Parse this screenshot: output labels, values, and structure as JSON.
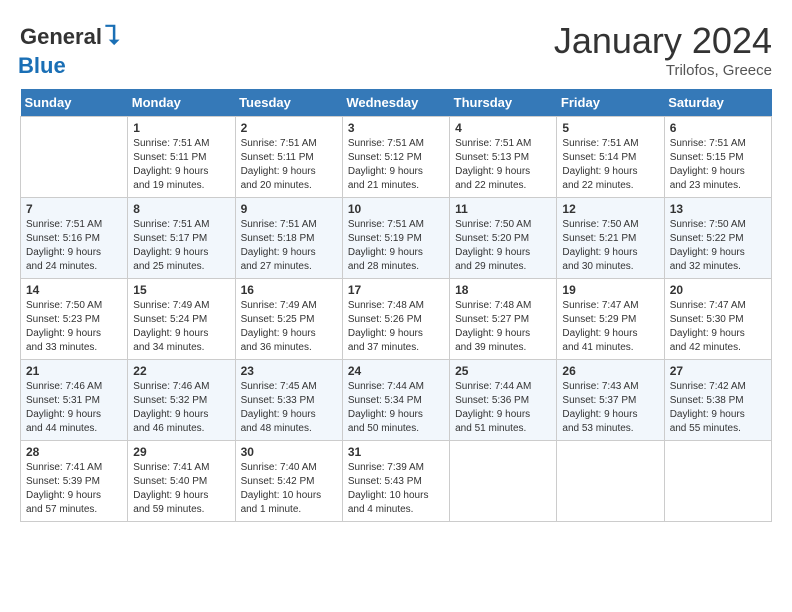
{
  "logo": {
    "general": "General",
    "blue": "Blue"
  },
  "title": "January 2024",
  "location": "Trilofos, Greece",
  "headers": [
    "Sunday",
    "Monday",
    "Tuesday",
    "Wednesday",
    "Thursday",
    "Friday",
    "Saturday"
  ],
  "weeks": [
    [
      {
        "day": "",
        "details": ""
      },
      {
        "day": "1",
        "details": "Sunrise: 7:51 AM\nSunset: 5:11 PM\nDaylight: 9 hours\nand 19 minutes."
      },
      {
        "day": "2",
        "details": "Sunrise: 7:51 AM\nSunset: 5:11 PM\nDaylight: 9 hours\nand 20 minutes."
      },
      {
        "day": "3",
        "details": "Sunrise: 7:51 AM\nSunset: 5:12 PM\nDaylight: 9 hours\nand 21 minutes."
      },
      {
        "day": "4",
        "details": "Sunrise: 7:51 AM\nSunset: 5:13 PM\nDaylight: 9 hours\nand 22 minutes."
      },
      {
        "day": "5",
        "details": "Sunrise: 7:51 AM\nSunset: 5:14 PM\nDaylight: 9 hours\nand 22 minutes."
      },
      {
        "day": "6",
        "details": "Sunrise: 7:51 AM\nSunset: 5:15 PM\nDaylight: 9 hours\nand 23 minutes."
      }
    ],
    [
      {
        "day": "7",
        "details": "Sunrise: 7:51 AM\nSunset: 5:16 PM\nDaylight: 9 hours\nand 24 minutes."
      },
      {
        "day": "8",
        "details": "Sunrise: 7:51 AM\nSunset: 5:17 PM\nDaylight: 9 hours\nand 25 minutes."
      },
      {
        "day": "9",
        "details": "Sunrise: 7:51 AM\nSunset: 5:18 PM\nDaylight: 9 hours\nand 27 minutes."
      },
      {
        "day": "10",
        "details": "Sunrise: 7:51 AM\nSunset: 5:19 PM\nDaylight: 9 hours\nand 28 minutes."
      },
      {
        "day": "11",
        "details": "Sunrise: 7:50 AM\nSunset: 5:20 PM\nDaylight: 9 hours\nand 29 minutes."
      },
      {
        "day": "12",
        "details": "Sunrise: 7:50 AM\nSunset: 5:21 PM\nDaylight: 9 hours\nand 30 minutes."
      },
      {
        "day": "13",
        "details": "Sunrise: 7:50 AM\nSunset: 5:22 PM\nDaylight: 9 hours\nand 32 minutes."
      }
    ],
    [
      {
        "day": "14",
        "details": "Sunrise: 7:50 AM\nSunset: 5:23 PM\nDaylight: 9 hours\nand 33 minutes."
      },
      {
        "day": "15",
        "details": "Sunrise: 7:49 AM\nSunset: 5:24 PM\nDaylight: 9 hours\nand 34 minutes."
      },
      {
        "day": "16",
        "details": "Sunrise: 7:49 AM\nSunset: 5:25 PM\nDaylight: 9 hours\nand 36 minutes."
      },
      {
        "day": "17",
        "details": "Sunrise: 7:48 AM\nSunset: 5:26 PM\nDaylight: 9 hours\nand 37 minutes."
      },
      {
        "day": "18",
        "details": "Sunrise: 7:48 AM\nSunset: 5:27 PM\nDaylight: 9 hours\nand 39 minutes."
      },
      {
        "day": "19",
        "details": "Sunrise: 7:47 AM\nSunset: 5:29 PM\nDaylight: 9 hours\nand 41 minutes."
      },
      {
        "day": "20",
        "details": "Sunrise: 7:47 AM\nSunset: 5:30 PM\nDaylight: 9 hours\nand 42 minutes."
      }
    ],
    [
      {
        "day": "21",
        "details": "Sunrise: 7:46 AM\nSunset: 5:31 PM\nDaylight: 9 hours\nand 44 minutes."
      },
      {
        "day": "22",
        "details": "Sunrise: 7:46 AM\nSunset: 5:32 PM\nDaylight: 9 hours\nand 46 minutes."
      },
      {
        "day": "23",
        "details": "Sunrise: 7:45 AM\nSunset: 5:33 PM\nDaylight: 9 hours\nand 48 minutes."
      },
      {
        "day": "24",
        "details": "Sunrise: 7:44 AM\nSunset: 5:34 PM\nDaylight: 9 hours\nand 50 minutes."
      },
      {
        "day": "25",
        "details": "Sunrise: 7:44 AM\nSunset: 5:36 PM\nDaylight: 9 hours\nand 51 minutes."
      },
      {
        "day": "26",
        "details": "Sunrise: 7:43 AM\nSunset: 5:37 PM\nDaylight: 9 hours\nand 53 minutes."
      },
      {
        "day": "27",
        "details": "Sunrise: 7:42 AM\nSunset: 5:38 PM\nDaylight: 9 hours\nand 55 minutes."
      }
    ],
    [
      {
        "day": "28",
        "details": "Sunrise: 7:41 AM\nSunset: 5:39 PM\nDaylight: 9 hours\nand 57 minutes."
      },
      {
        "day": "29",
        "details": "Sunrise: 7:41 AM\nSunset: 5:40 PM\nDaylight: 9 hours\nand 59 minutes."
      },
      {
        "day": "30",
        "details": "Sunrise: 7:40 AM\nSunset: 5:42 PM\nDaylight: 10 hours\nand 1 minute."
      },
      {
        "day": "31",
        "details": "Sunrise: 7:39 AM\nSunset: 5:43 PM\nDaylight: 10 hours\nand 4 minutes."
      },
      {
        "day": "",
        "details": ""
      },
      {
        "day": "",
        "details": ""
      },
      {
        "day": "",
        "details": ""
      }
    ]
  ]
}
